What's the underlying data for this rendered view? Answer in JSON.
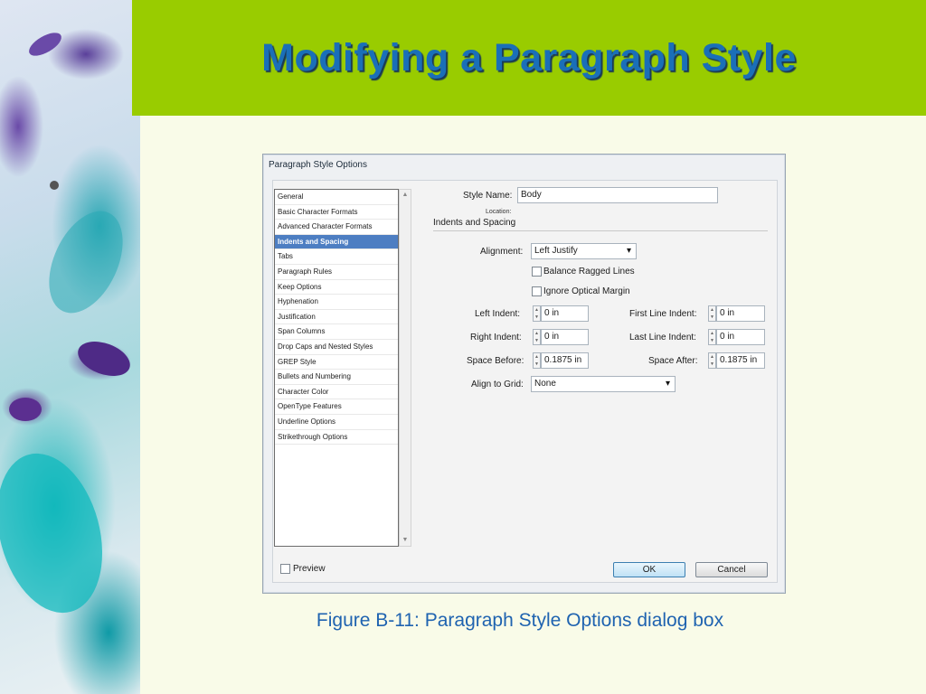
{
  "slide": {
    "title": "Modifying a Paragraph Style",
    "caption": "Figure B-11: Paragraph Style Options dialog box"
  },
  "dialog": {
    "title": "Paragraph Style Options",
    "categories": [
      "General",
      "Basic Character Formats",
      "Advanced Character Formats",
      "Indents and Spacing",
      "Tabs",
      "Paragraph Rules",
      "Keep Options",
      "Hyphenation",
      "Justification",
      "Span Columns",
      "Drop Caps and Nested Styles",
      "GREP Style",
      "Bullets and Numbering",
      "Character Color",
      "OpenType Features",
      "Underline Options",
      "Strikethrough Options"
    ],
    "selected_category": "Indents and Spacing",
    "style_name_label": "Style Name:",
    "style_name_value": "Body",
    "location_label": "Location:",
    "section_title": "Indents and Spacing",
    "alignment_label": "Alignment:",
    "alignment_value": "Left Justify",
    "balance_label": "Balance Ragged Lines",
    "ignore_label": "Ignore Optical Margin",
    "left_indent_label": "Left Indent:",
    "left_indent_value": "0 in",
    "first_line_indent_label": "First Line Indent:",
    "first_line_indent_value": "0 in",
    "right_indent_label": "Right Indent:",
    "right_indent_value": "0 in",
    "last_line_indent_label": "Last Line Indent:",
    "last_line_indent_value": "0 in",
    "space_before_label": "Space Before:",
    "space_before_value": "0.1875 in",
    "space_after_label": "Space After:",
    "space_after_value": "0.1875 in",
    "align_grid_label": "Align to Grid:",
    "align_grid_value": "None",
    "preview_label": "Preview",
    "ok_label": "OK",
    "cancel_label": "Cancel"
  }
}
